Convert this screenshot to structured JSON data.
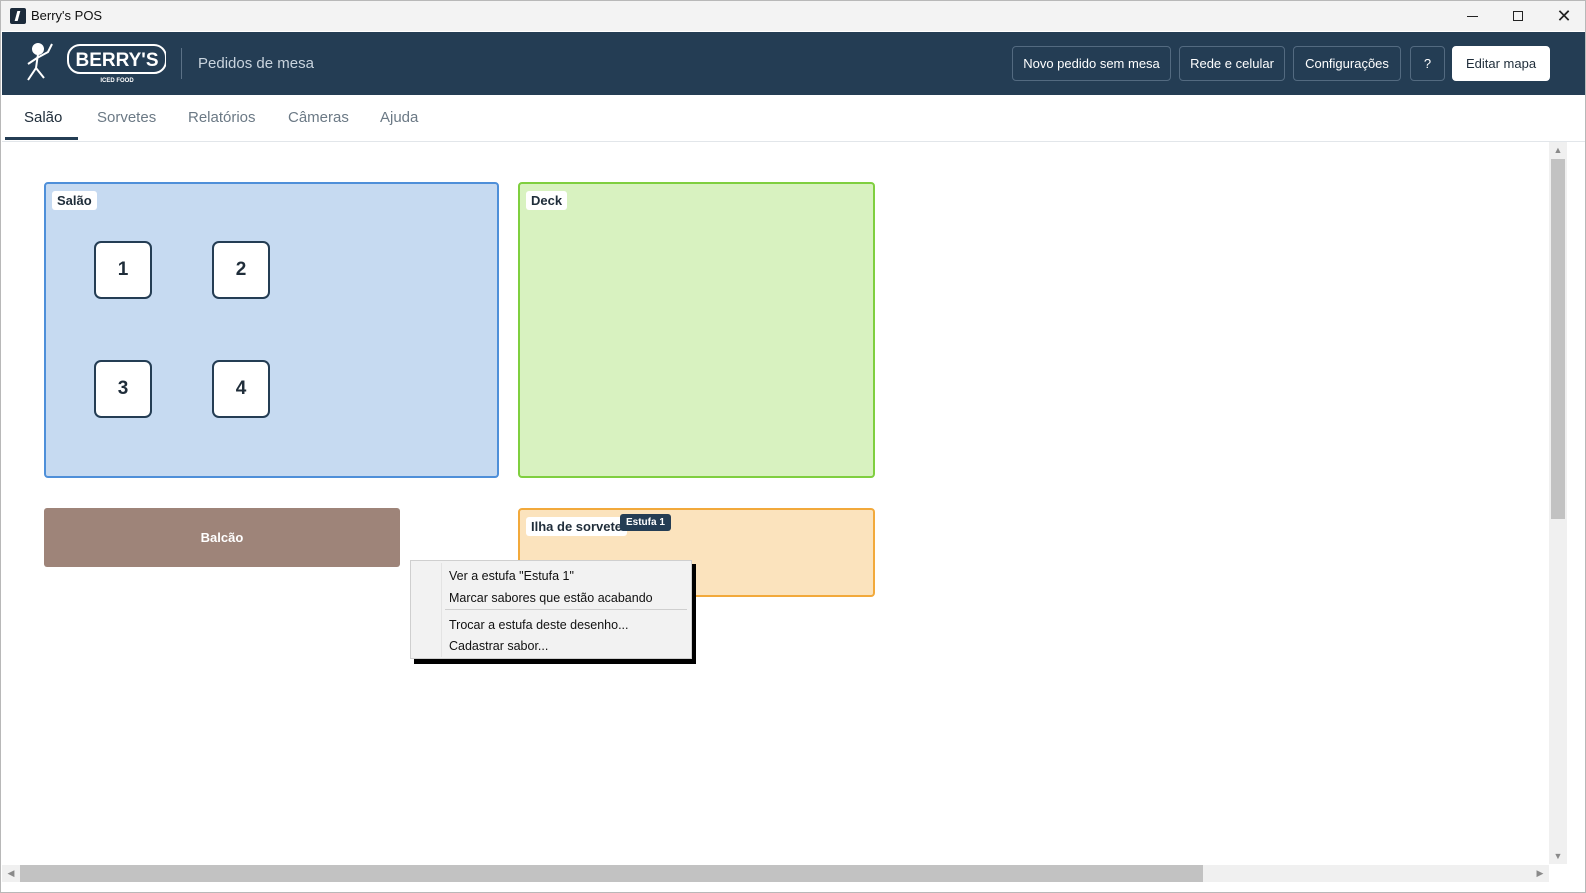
{
  "window": {
    "title": "Berry's POS"
  },
  "header": {
    "logo_text": "BERRY'S",
    "logo_subtext": "ICED FOOD",
    "title": "Pedidos de mesa",
    "buttons": {
      "new_order": "Novo pedido sem mesa",
      "network": "Rede e celular",
      "settings": "Configurações",
      "help": "?",
      "edit_map": "Editar mapa"
    }
  },
  "tabs": [
    {
      "label": "Salão",
      "active": true
    },
    {
      "label": "Sorvetes"
    },
    {
      "label": "Relatórios"
    },
    {
      "label": "Câmeras"
    },
    {
      "label": "Ajuda"
    }
  ],
  "map": {
    "zones": {
      "salao": {
        "label": "Salão",
        "color": "#c6daf1",
        "border": "#4e8fd9"
      },
      "deck": {
        "label": "Deck",
        "color": "#d8f2c0",
        "border": "#7fcf3f"
      },
      "balcao": {
        "label": "Balcão",
        "color": "#9e8479"
      },
      "ilha": {
        "label": "Ilha de sorvete",
        "badge": "Estufa 1",
        "color": "#fbe3bd",
        "border": "#f2a93b"
      }
    },
    "tables": [
      "1",
      "2",
      "3",
      "4"
    ]
  },
  "context_menu": {
    "items": [
      "Ver a estufa \"Estufa 1\"",
      "Marcar sabores que estão acabando",
      "Trocar a estufa deste desenho...",
      "Cadastrar sabor..."
    ]
  },
  "colors": {
    "header_bg": "#243d54",
    "accent": "#243d54"
  }
}
